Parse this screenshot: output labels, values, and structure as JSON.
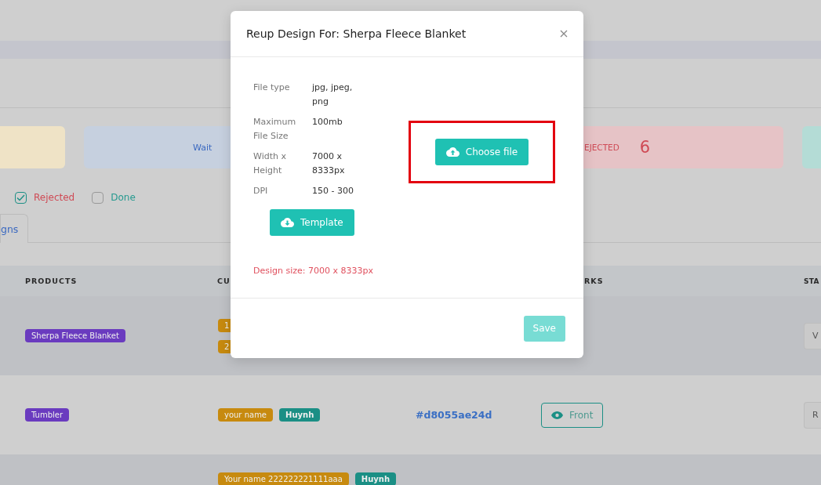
{
  "stat_cards": [
    {
      "color": "#efe3c6"
    },
    {
      "color": "#c6d0df",
      "label": "Wait"
    },
    {
      "color": "#e6c3c6"
    },
    {
      "color": "#b4dcd6"
    }
  ],
  "rejected_card": {
    "label": "EJECTED",
    "count": "6"
  },
  "filters": [
    {
      "label": "Rejected",
      "checked": true,
      "color": "#cf4a55"
    },
    {
      "label": "Done",
      "checked": false,
      "color": "#279a90"
    }
  ],
  "tabs": [
    {
      "label": "gns",
      "selected": true
    }
  ],
  "table": {
    "columns": [
      "PRODUCTS",
      "CU",
      "RKS",
      "STA"
    ],
    "rows": [
      {
        "product": "Sherpa Fleece Blanket",
        "stacked": true,
        "tags": [
          {
            "kind": "custom",
            "text": "1"
          },
          {
            "kind": "custom",
            "text": "2"
          }
        ],
        "status": "V"
      },
      {
        "product": "Tumbler",
        "stacked": false,
        "tags": [
          {
            "kind": "custom",
            "text": "your name"
          },
          {
            "kind": "name",
            "text": "Huynh"
          }
        ],
        "code": "#d8055ae24d",
        "preview": "Front",
        "status": "R"
      },
      {
        "stacked": false,
        "tags": [
          {
            "kind": "custom",
            "text": "Your name 222222221111aaa"
          },
          {
            "kind": "name",
            "text": "Huynh"
          }
        ]
      }
    ]
  },
  "modal": {
    "title": "Reup Design For: Sherpa Fleece Blanket",
    "specs": [
      {
        "label": "File type",
        "value": "jpg, jpeg, png"
      },
      {
        "label": "Maximum File Size",
        "value": "100mb"
      },
      {
        "label": "Width x Height",
        "value": "7000 x 8333px"
      },
      {
        "label": "DPI",
        "value": "150 - 300"
      }
    ],
    "template_button": "Template",
    "upload_button": {
      "label": "Choose file",
      "highlighted": true
    },
    "design_size": "Design size: 7000 x 8333px",
    "save_button": {
      "label": "Save",
      "disabled": true
    }
  }
}
